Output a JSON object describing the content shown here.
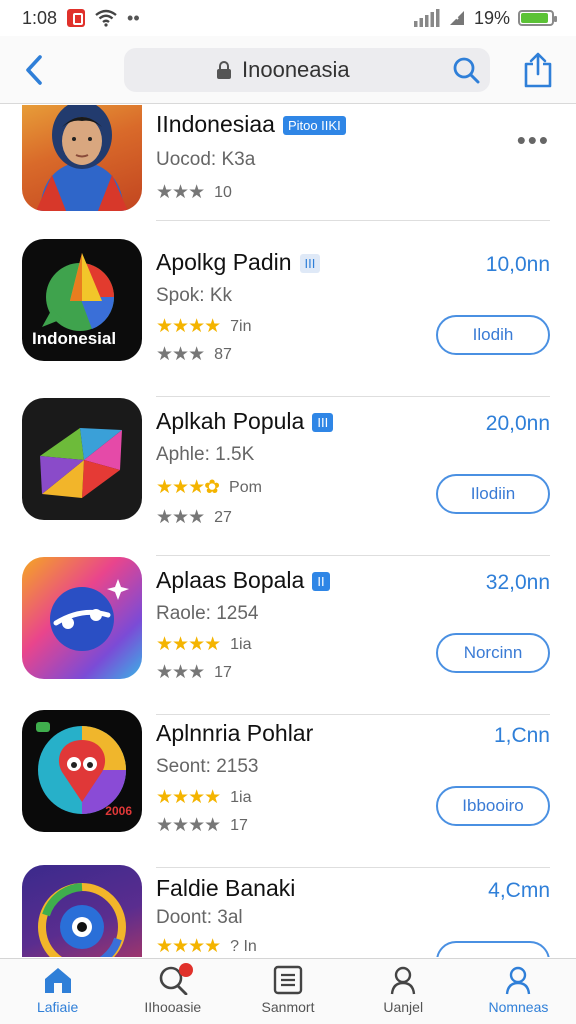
{
  "status_bar": {
    "time": "1:08",
    "battery": "19%",
    "battery_level": 0.9
  },
  "nav": {
    "search_text": "Inooneasia"
  },
  "apps": [
    {
      "name": "IIndonesiaa",
      "tag": "Pitoo IIKI",
      "subtitle": "Uocod: K3a",
      "gray_stars": "★★★",
      "gray_count": "10"
    },
    {
      "name": "Apolkg Padin",
      "tag": "III",
      "subtitle": "Spok: Kk",
      "gold_stars": "★★★★",
      "gold_count": "7in",
      "gray_stars": "★★★",
      "gray_count": "87",
      "price": "10,0nn",
      "action": "Ilodih",
      "icon_text": "Indonesial"
    },
    {
      "name": "Aplkah Popula",
      "tag": "III",
      "subtitle": "Aphle: 1.5K",
      "gold_stars": "★★★✿",
      "gold_count": "Pom",
      "gray_stars": "★★★",
      "gray_count": "27",
      "price": "20,0nn",
      "action": "Ilodiin"
    },
    {
      "name": "Aplaas Bopala",
      "tag": "II",
      "subtitle": "Raole: 1254",
      "gold_stars": "★★★★",
      "gold_count": "1ia",
      "gray_stars": "★★★",
      "gray_count": "17",
      "price": "32,0nn",
      "action": "Norcinn"
    },
    {
      "name": "Aplnnria Pohlar",
      "subtitle": "Seont: 2153",
      "gold_stars": "★★★★",
      "gold_count": "1ia",
      "gray_stars": "★★★★",
      "gray_count": "17",
      "price": "1,Cnn",
      "action": "Ibbooiro",
      "icon_text": "2006"
    },
    {
      "name": "Faldie Banaki",
      "subtitle": "Doont: 3al",
      "gold_stars": "★★★★",
      "gold_count": "? In",
      "price": "4,Cmn",
      "action": ""
    }
  ],
  "tabs": [
    {
      "label": "Lafiaie"
    },
    {
      "label": "IIhooasie"
    },
    {
      "label": "Sanmort"
    },
    {
      "label": "Uanjel"
    },
    {
      "label": "Nomneas"
    }
  ],
  "colors": {
    "accent": "#2f7fd8",
    "star": "#f4b400",
    "badge": "#e0312b",
    "battery": "#5bc236"
  }
}
